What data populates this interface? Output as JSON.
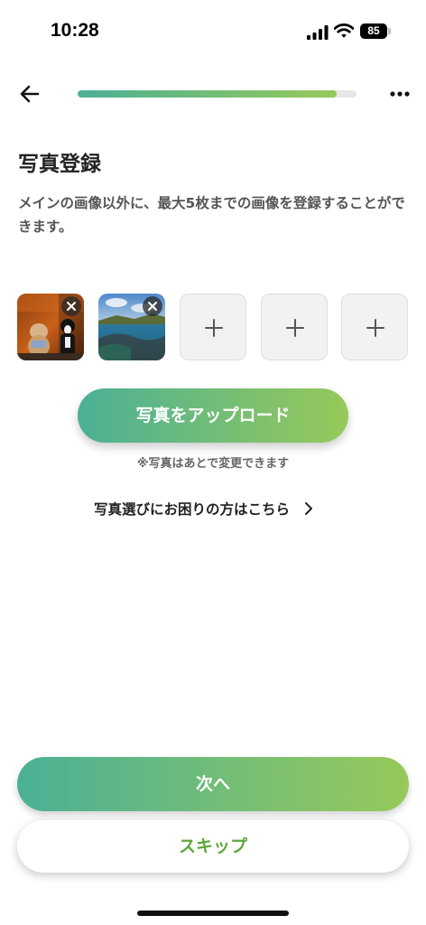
{
  "status_bar": {
    "time": "10:28",
    "battery": "85",
    "icons": [
      "signal-icon",
      "wifi-icon",
      "battery-icon"
    ]
  },
  "nav": {
    "back_icon": "arrow-left-icon",
    "more_icon": "ellipsis-icon",
    "progress": 0.93
  },
  "page": {
    "title": "写真登録",
    "description": "メインの画像以外に、最大5枚までの画像を登録することができます。"
  },
  "photos": {
    "slots": [
      {
        "state": "filled",
        "content": "dogs-photo"
      },
      {
        "state": "filled",
        "content": "coast-photo"
      },
      {
        "state": "empty",
        "icon": "plus-icon"
      },
      {
        "state": "empty",
        "icon": "plus-icon"
      },
      {
        "state": "empty",
        "icon": "plus-icon"
      }
    ],
    "remove_icon": "close-icon"
  },
  "upload": {
    "button_label": "写真をアップロード",
    "note": "※写真はあとで変更できます"
  },
  "help": {
    "label": "写真選びにお困りの方はこちら",
    "icon": "chevron-right-icon"
  },
  "footer": {
    "next_label": "次へ",
    "skip_label": "スキップ"
  },
  "colors": {
    "gradient_start": "#4bb096",
    "gradient_end": "#97c95a",
    "skip_text": "#5fa83c",
    "slot_bg": "#f2f2f2"
  }
}
